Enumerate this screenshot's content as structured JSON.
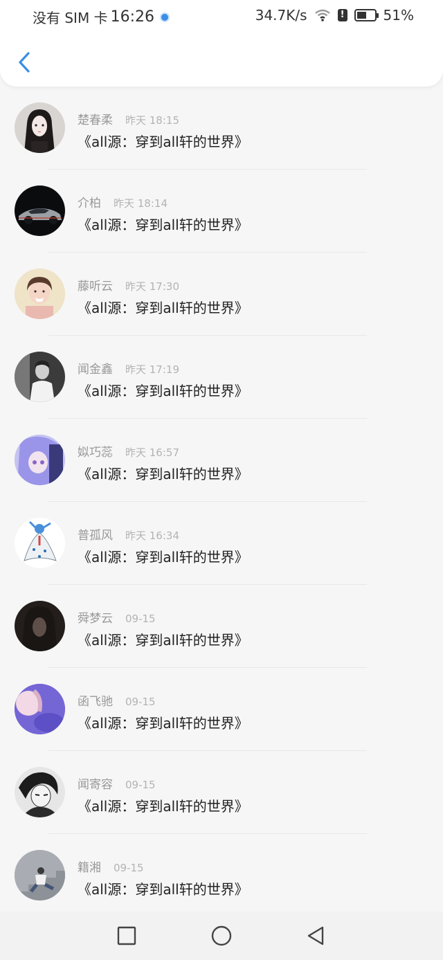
{
  "status_bar": {
    "carrier": "没有 SIM 卡",
    "time": "16:26",
    "speed": "34.7K/s",
    "battery_pct": "51%",
    "battery_level": 0.51
  },
  "header": {
    "back_icon": "chevron-left-icon",
    "accent": "#3a8ee6"
  },
  "items": [
    {
      "name": "楚春柔",
      "date": "昨天 18:15",
      "message": "《all源：穿到all轩的世界》",
      "avatar": "girl-portrait"
    },
    {
      "name": "介柏",
      "date": "昨天 18:14",
      "message": "《all源：穿到all轩的世界》",
      "avatar": "car-dark"
    },
    {
      "name": "藤听云",
      "date": "昨天 17:30",
      "message": "《all源：穿到all轩的世界》",
      "avatar": "girl-photo"
    },
    {
      "name": "闻金鑫",
      "date": "昨天 17:19",
      "message": "《all源：穿到all轩的世界》",
      "avatar": "boy-bw"
    },
    {
      "name": "姒巧蕊",
      "date": "昨天 16:57",
      "message": "《all源：穿到all轩的世界》",
      "avatar": "anime-purple"
    },
    {
      "name": "普孤风",
      "date": "昨天 16:34",
      "message": "《all源：穿到all轩的世界》",
      "avatar": "pokemon-white"
    },
    {
      "name": "舜梦云",
      "date": "09-15",
      "message": "《all源：穿到all轩的世界》",
      "avatar": "dark-portrait"
    },
    {
      "name": "函飞驰",
      "date": "09-15",
      "message": "《all源：穿到all轩的世界》",
      "avatar": "purple-abstract"
    },
    {
      "name": "闻寄容",
      "date": "09-15",
      "message": "《all源：穿到all轩的世界》",
      "avatar": "anime-bw"
    },
    {
      "name": "籍湘",
      "date": "09-15",
      "message": "《all源：穿到all轩的世界》",
      "avatar": "boy-stairs"
    }
  ],
  "nav": {
    "square_icon": "square-icon",
    "circle_icon": "circle-icon",
    "back_icon": "triangle-back-icon"
  }
}
